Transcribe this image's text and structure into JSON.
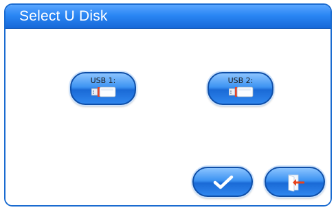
{
  "dialog": {
    "title": "Select U Disk"
  },
  "drives": [
    {
      "label": "USB 1:",
      "icon": "usb-drive-icon"
    },
    {
      "label": "USB 2:",
      "icon": "usb-drive-icon"
    }
  ],
  "actions": {
    "confirm_icon": "check-icon",
    "exit_icon": "exit-door-icon"
  },
  "colors": {
    "title_bar": "#2a86f4",
    "button_blue": "#3d93f2",
    "exit_arrow": "#e8431b"
  }
}
